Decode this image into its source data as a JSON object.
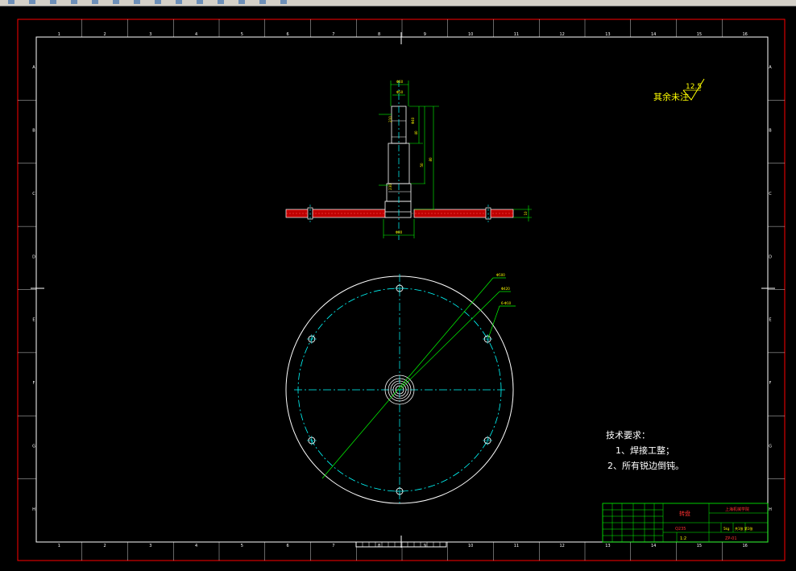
{
  "toolbar": {
    "icons": [
      "new-icon",
      "open-icon",
      "save-icon",
      "print-icon",
      "cut-icon",
      "copy-icon",
      "paste-icon",
      "undo-icon",
      "redo-icon",
      "pan-icon",
      "zoom-icon",
      "properties-icon",
      "layer-icon",
      "help-icon"
    ]
  },
  "drawing": {
    "col_labels": [
      "1",
      "2",
      "3",
      "4",
      "5",
      "6",
      "7",
      "8",
      "9",
      "10",
      "11",
      "12",
      "13",
      "14",
      "15",
      "16"
    ],
    "row_labels": [
      "A",
      "B",
      "C",
      "D",
      "E",
      "F",
      "G",
      "H"
    ],
    "surface_roughness": {
      "value": "12.5",
      "note": "其余未注"
    },
    "tech_requirements": {
      "title": "技术要求：",
      "items": [
        "1、焊接工整；",
        "2、所有锐边倒钝。"
      ]
    },
    "top_view_dims": [
      "Φ60",
      "Φ50",
      "Φ40",
      "40",
      "50",
      "80",
      "210",
      "230",
      "Φ80",
      "10"
    ],
    "plan_view_leaders": [
      "Φ500",
      "Φ420",
      "6-Φ10"
    ],
    "title_block": {
      "part_name": "转盘",
      "material": "Q235",
      "scale": "1:2",
      "company": "上海机械学院",
      "drawing_no": "ZP-01",
      "weight": "5kg",
      "sheet": "共1张 第1张"
    }
  },
  "colors": {
    "background": "#000000",
    "border": "#ff0000",
    "frame": "#ffffff",
    "dimension": "#00ff00",
    "center_line": "#00ffff",
    "section_fill": "#c00000",
    "annotation": "#ffff00"
  }
}
